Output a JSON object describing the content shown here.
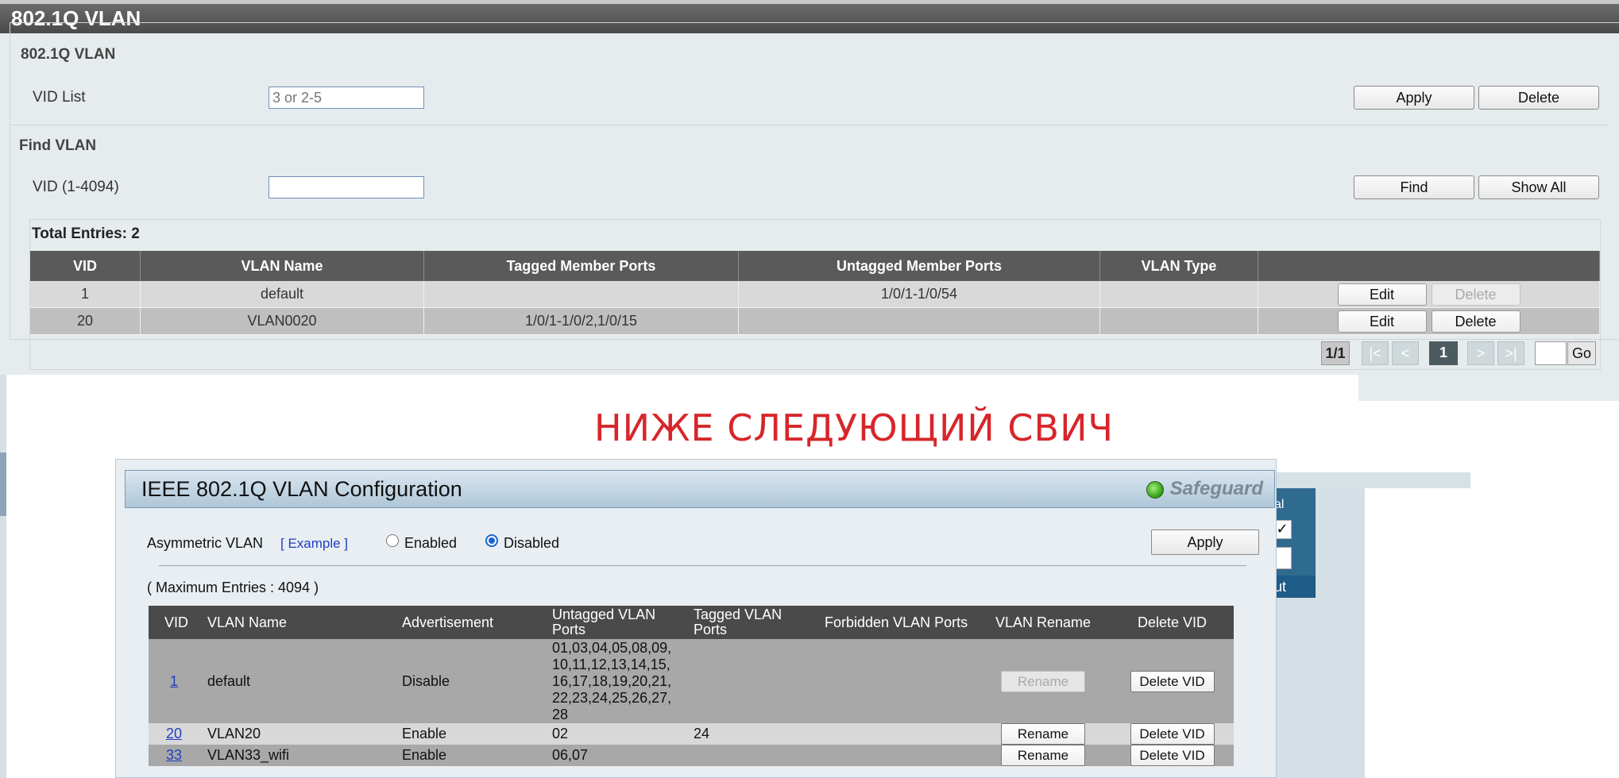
{
  "top": {
    "title": "802.1Q VLAN",
    "fieldset_legend": "802.1Q VLAN",
    "vid_list_label": "VID List",
    "vid_list_placeholder": "3 or 2-5",
    "apply_label": "Apply",
    "delete_label": "Delete",
    "find_section": "Find VLAN",
    "vid_label": "VID (1-4094)",
    "find_label": "Find",
    "show_all_label": "Show All",
    "total_entries": "Total Entries: 2",
    "columns": [
      "VID",
      "VLAN Name",
      "Tagged Member Ports",
      "Untagged Member Ports",
      "VLAN Type",
      ""
    ],
    "rows": [
      {
        "vid": "1",
        "name": "default",
        "tagged": "",
        "untagged": "1/0/1-1/0/54",
        "type": "",
        "edit": "Edit",
        "delete": "Delete",
        "delete_disabled": true
      },
      {
        "vid": "20",
        "name": "VLAN0020",
        "tagged": "1/0/1-1/0/2,1/0/15",
        "untagged": "",
        "type": "",
        "edit": "Edit",
        "delete": "Delete",
        "delete_disabled": false
      }
    ],
    "pager": {
      "page": "1/1",
      "first": "|<",
      "prev": "<",
      "current": "1",
      "next": ">",
      "last": ">|",
      "go": "Go"
    }
  },
  "note": "НИЖЕ СЛЕДУЮЩИЙ СВИЧ",
  "bottom": {
    "title": "IEEE 802.1Q VLAN Configuration",
    "safeguard": "Safeguard",
    "asym_label": "Asymmetric VLAN",
    "example_link": "[ Example ]",
    "enabled_label": "Enabled",
    "disabled_label": "Disabled",
    "selected": "Disabled",
    "apply_label": "Apply",
    "max_entries": "( Maximum Entries : 4094 )",
    "columns": [
      "VID",
      "VLAN Name",
      "Advertisement",
      "Untagged VLAN Ports",
      "Tagged VLAN Ports",
      "Forbidden VLAN Ports",
      "VLAN Rename",
      "Delete VID"
    ],
    "rows": [
      {
        "vid": "1",
        "name": "default",
        "adv": "Disable",
        "untagged": "01,03,04,05,08,09,\n10,11,12,13,14,15,\n16,17,18,19,20,21,\n22,23,24,25,26,27,\n28",
        "tagged": "",
        "forbidden": "",
        "rename": "Rename",
        "rename_disabled": true,
        "delete": "Delete VID"
      },
      {
        "vid": "20",
        "name": "VLAN20",
        "adv": "Enable",
        "untagged": "02",
        "tagged": "24",
        "forbidden": "",
        "rename": "Rename",
        "rename_disabled": false,
        "delete": "Delete VID"
      },
      {
        "vid": "33",
        "name": "VLAN33_wifi",
        "adv": "Enable",
        "untagged": "06,07",
        "tagged": "",
        "forbidden": "",
        "rename": "Rename",
        "rename_disabled": false,
        "delete": "Delete VID"
      }
    ],
    "side_panel": {
      "text1": "al",
      "check": "✓",
      "text2": "ut"
    }
  }
}
